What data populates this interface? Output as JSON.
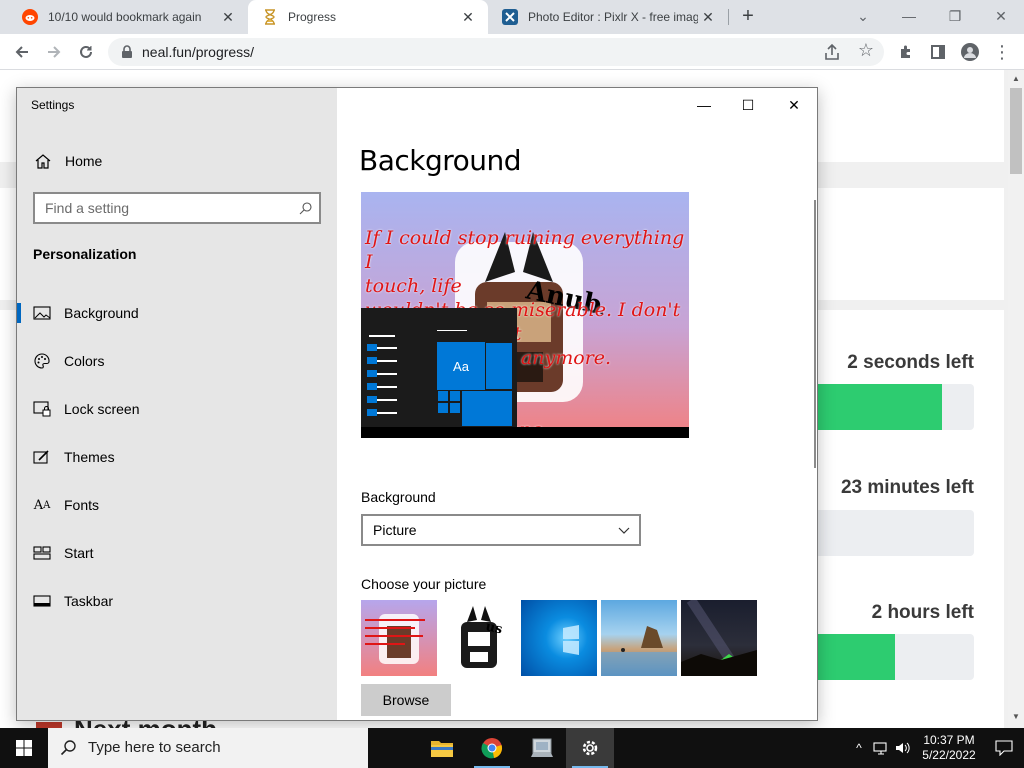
{
  "browser": {
    "tabs": [
      {
        "title": "10/10 would bookmark again",
        "favicon": "reddit-icon",
        "active": false
      },
      {
        "title": "Progress",
        "favicon": "hourglass-icon",
        "active": true
      },
      {
        "title": "Photo Editor : Pixlr X - free image",
        "favicon": "pixlr-icon",
        "active": false
      }
    ],
    "new_tab_label": "+",
    "address": "neal.fun/progress/",
    "nav_icons": [
      "back-icon",
      "forward-icon",
      "reload-icon"
    ],
    "toolbar_icons": [
      "share-icon",
      "star-icon",
      "extensions-icon",
      "sidepanel-icon",
      "profile-icon",
      "menu-icon"
    ]
  },
  "background_page": {
    "timers": [
      {
        "label": "2 seconds left",
        "progress": 0.8
      },
      {
        "label": "23 minutes left",
        "progress": 0.0
      },
      {
        "label": "2 hours left",
        "progress": 0.5
      }
    ],
    "bottom_heading": "Next month"
  },
  "settings": {
    "app_title": "Settings",
    "home_label": "Home",
    "search_placeholder": "Find a setting",
    "section_title": "Personalization",
    "nav_items": [
      {
        "label": "Background",
        "icon": "picture-icon",
        "active": true
      },
      {
        "label": "Colors",
        "icon": "palette-icon",
        "active": false
      },
      {
        "label": "Lock screen",
        "icon": "lock-screen-icon",
        "active": false
      },
      {
        "label": "Themes",
        "icon": "themes-icon",
        "active": false
      },
      {
        "label": "Fonts",
        "icon": "fonts-icon",
        "active": false
      },
      {
        "label": "Start",
        "icon": "start-icon",
        "active": false
      },
      {
        "label": "Taskbar",
        "icon": "taskbar-icon",
        "active": false
      }
    ],
    "page_title": "Background",
    "preview": {
      "caption": "If I could stop ruining everything I\ntouch, life\nwouldn't be so miserable. I don't\neven know what\n...happen to me anymore. Besides\n... up\n...imagine ... alone.",
      "tile_label": "Aa",
      "sticker_text": "Anubis"
    },
    "background_label": "Background",
    "background_value": "Picture",
    "choose_label": "Choose your picture",
    "browse_label": "Browse"
  },
  "taskbar": {
    "search_placeholder": "Type here to search",
    "apps": [
      "file-explorer-icon",
      "chrome-icon",
      "photos-icon",
      "settings-gear-icon"
    ],
    "time": "10:37 PM",
    "date": "5/22/2022"
  },
  "colors": {
    "accent": "#0078d7",
    "progress_green": "#2dcc70",
    "preview_text_red": "#e01515"
  }
}
